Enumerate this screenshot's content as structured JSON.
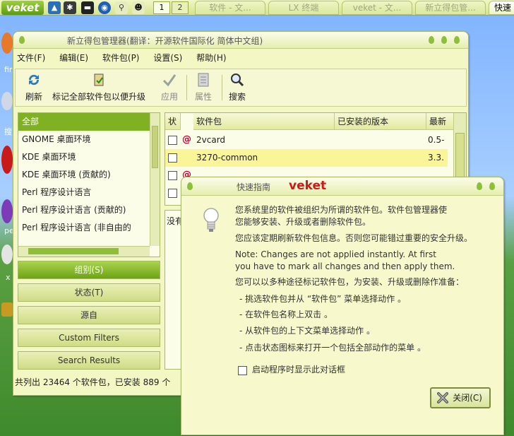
{
  "taskbar": {
    "logo": "veket",
    "quicklaunch_icons": [
      "install-icon",
      "gear-icon",
      "terminal-icon",
      "browser-icon",
      "search-icon",
      "qq-penguin-icon"
    ],
    "workspaces": [
      "1",
      "2"
    ],
    "tasks": [
      "软件 - 文...",
      "LX 终端",
      "veket - 文...",
      "新立得包管...",
      "快速"
    ]
  },
  "desktop": {
    "labels": [
      "fir",
      "搜",
      "pe",
      "x"
    ]
  },
  "main_window": {
    "title": "新立得包管理器(翻译：开源软件国际化 简体中文组)",
    "menu": [
      "文件(F)",
      "编辑(E)",
      "软件包(P)",
      "设置(S)",
      "帮助(H)"
    ],
    "toolbar": {
      "refresh": "刷新",
      "mark_upgrades": "标记全部软件包以便升级",
      "apply": "应用",
      "properties": "属性",
      "search": "搜索"
    },
    "categories": [
      "全部",
      "GNOME 桌面环境",
      "KDE 桌面环境",
      "KDE 桌面环境 (贡献的)",
      "Perl 程序设计语言",
      "Perl 程序设计语言 (贡献的)",
      "Perl 程序设计语言 (非自由的"
    ],
    "filter_buttons": [
      "组别(S)",
      "状态(T)",
      "源自",
      "Custom Filters",
      "Search Results"
    ],
    "table_headers": [
      "状",
      "软件包",
      "已安装的版本",
      "最新"
    ],
    "packages": [
      {
        "name": "2vcard",
        "installed": "",
        "latest": "0.5-"
      },
      {
        "name": "3270-common",
        "installed": "",
        "latest": "3.3."
      },
      {
        "name": "",
        "installed": "",
        "latest": ""
      },
      {
        "name": "",
        "installed": "",
        "latest": ""
      }
    ],
    "description_partial": "没有",
    "status": "共列出 23464 个软件包，已安装 889 个"
  },
  "dialog": {
    "title": "快速指南",
    "brand": "veket",
    "paragraphs": [
      "您系统里的软件被组织为所谓的软件包。软件包管理器使",
      "您能够安装、升级或者删除软件包。",
      "您应该定期刷新软件包信息。否则您可能错过重要的安全升级。",
      "Note: Changes are not applied instantly. At first",
      "you have to mark all changes and then apply them.",
      "您可以以多种途径标记软件包，为安装、升级或删除作准备：",
      "- 挑选软件包并从 “软件包” 菜单选择动作 。",
      "- 在软件包名称上双击 。",
      "- 从软件包的上下文菜单选择动作 。",
      "- 点击状态图标来打开一个包括全部动作的菜单 。"
    ],
    "checkbox_label": "启动程序时显示此对话框",
    "close_label": "关闭(C)"
  },
  "colors": {
    "accent_green": "#7fb123",
    "panel_bg": "#f3f7c4",
    "selected_row": "#fbf59a",
    "brand_red": "#d01818"
  }
}
